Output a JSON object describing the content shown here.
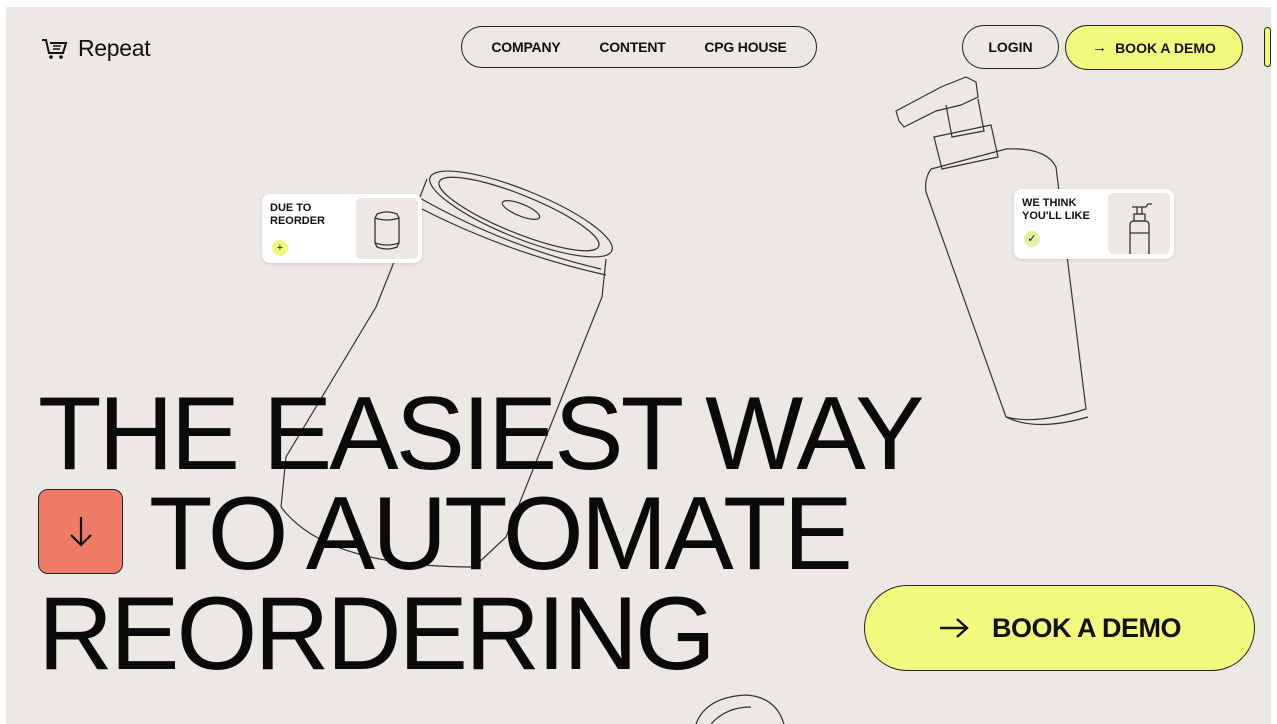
{
  "brand": {
    "name": "Repeat",
    "logo_icon": "cart-repeat-icon"
  },
  "nav": {
    "links": [
      "COMPANY",
      "CONTENT",
      "CPG HOUSE"
    ]
  },
  "header": {
    "login_label": "LOGIN",
    "demo_label": "BOOK A DEMO",
    "demo_icon": "arrow-right-icon"
  },
  "cards": {
    "due": {
      "label": "DUE TO REORDER",
      "badge_icon": "plus-icon",
      "badge": "+",
      "image_icon": "can-icon"
    },
    "think": {
      "label": "WE THINK YOU'LL LIKE",
      "badge_icon": "check-icon",
      "badge": "✓",
      "image_icon": "pump-bottle-icon"
    }
  },
  "hero": {
    "line1": "THE EASIEST WAY",
    "line2": "TO AUTOMATE",
    "line3": "REORDERING",
    "scroll_icon": "arrow-down-icon",
    "cta_label": "BOOK A DEMO",
    "cta_icon": "arrow-right-icon"
  },
  "colors": {
    "background": "#ece8e3",
    "accent_yellow": "#f1fa7d",
    "accent_coral": "#ee7b66",
    "ink": "#111111"
  }
}
